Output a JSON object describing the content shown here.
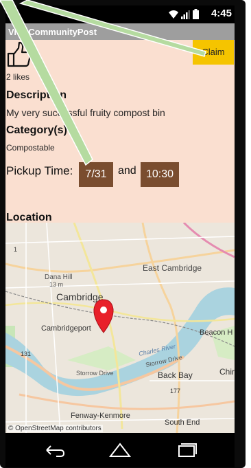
{
  "status_bar": {
    "time": "4:45",
    "icons": [
      "wifi-icon",
      "signal-icon",
      "battery-icon"
    ]
  },
  "action_bar": {
    "title": "ViewCommunityPost"
  },
  "post": {
    "likes": "2 likes",
    "claim_label": "Claim",
    "description_heading": "Description",
    "description": "My very successful fruity compost bin",
    "category_heading": "Category(s)",
    "category": "Compostable",
    "pickup_label": "Pickup Time:",
    "pickup_date": "7/31",
    "pickup_and": "and",
    "pickup_time": "10:30",
    "location_heading": "Location"
  },
  "map": {
    "labels": {
      "east_cambridge": "East Cambridge",
      "dana_hill": "Dana Hill",
      "elevation": "13 m",
      "cambridge": "Cambridge",
      "cambridgeport": "Cambridgeport",
      "beacon_hill": "Beacon H",
      "charles_river": "Charles River",
      "storrow_drive_1": "Storrow Drive",
      "storrow_drive_2": "Storrow Drive",
      "back_bay": "Back Bay",
      "chinatown": "Chir",
      "fenway": "Fenway-Kenmore",
      "south_end": "South End",
      "route_1": "1",
      "route_131": "131",
      "route_177": "177"
    },
    "attribution": "© OpenStreetMap contributors"
  },
  "nav_bar": {
    "icons": [
      "back-icon",
      "home-icon",
      "recents-icon"
    ]
  },
  "colors": {
    "content_bg": "#fadfd0",
    "claim_bg": "#f5c400",
    "chip_bg": "#7a4d2f",
    "action_bar_bg": "#9e9e9e",
    "marker": "#e8202a",
    "water": "#aad3df",
    "annotation_arrow": "#b5dba0"
  }
}
